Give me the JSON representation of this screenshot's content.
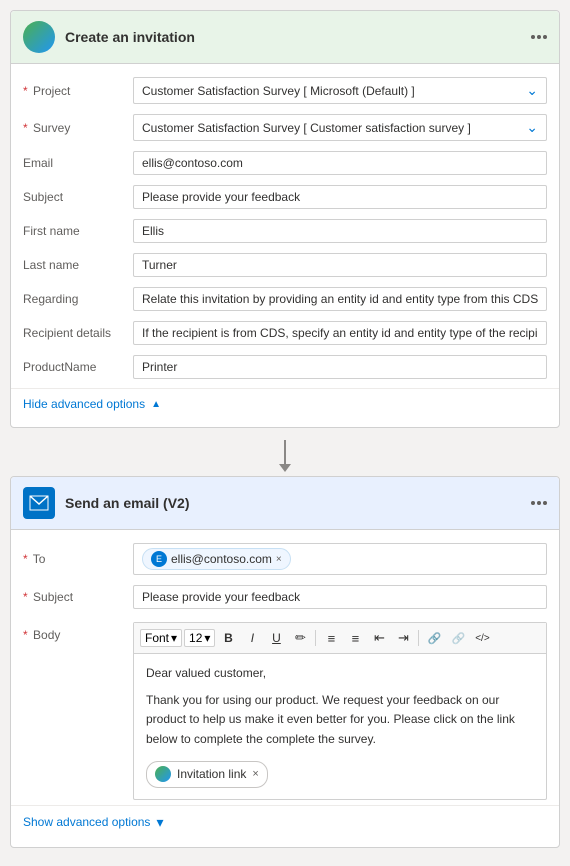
{
  "card1": {
    "title": "Create an invitation",
    "fields": [
      {
        "label": "Project",
        "required": true,
        "type": "select",
        "value": "Customer Satisfaction Survey [ Microsoft (Default) ]"
      },
      {
        "label": "Survey",
        "required": true,
        "type": "select",
        "value": "Customer Satisfaction Survey [ Customer satisfaction survey ]"
      },
      {
        "label": "Email",
        "required": false,
        "type": "input",
        "value": "ellis@contoso.com"
      },
      {
        "label": "Subject",
        "required": false,
        "type": "input",
        "value": "Please provide your feedback"
      },
      {
        "label": "First name",
        "required": false,
        "type": "input",
        "value": "Ellis"
      },
      {
        "label": "Last name",
        "required": false,
        "type": "input",
        "value": "Turner"
      },
      {
        "label": "Regarding",
        "required": false,
        "type": "input",
        "value": "Relate this invitation by providing an entity id and entity type from this CDS t"
      },
      {
        "label": "Recipient details",
        "required": false,
        "type": "input",
        "value": "If the recipient is from CDS, specify an entity id and entity type of the recipient"
      },
      {
        "label": "ProductName",
        "required": false,
        "type": "input",
        "value": "Printer"
      }
    ],
    "toggle_label": "Hide advanced options",
    "toggle_chevron": "▲"
  },
  "card2": {
    "title": "Send an email (V2)",
    "to_tag_email": "ellis@contoso.com",
    "to_tag_initial": "E",
    "subject_value": "Please provide your feedback",
    "body_font": "Font",
    "body_size": "12",
    "body_content_line1": "Dear valued customer,",
    "body_content_line2": "Thank you for using our product. We request your feedback on our product to help us make it even better for you. Please click on the link below to complete the complete the survey.",
    "invitation_tag_label": "Invitation link",
    "toggle_label": "Show advanced options",
    "toggle_chevron": "▾",
    "toolbar": {
      "bold": "B",
      "italic": "I",
      "underline": "U",
      "highlight": "✏",
      "ol": "≡",
      "ul": "≡",
      "indent_left": "⇐",
      "indent_right": "⇒",
      "link": "🔗",
      "unlink": "⛓",
      "code": "</>",
      "chevron_font": "▾",
      "chevron_size": "▾"
    }
  },
  "labels": {
    "required_star": "*",
    "to_label": "To",
    "subject_label": "Subject",
    "body_label": "Body"
  }
}
